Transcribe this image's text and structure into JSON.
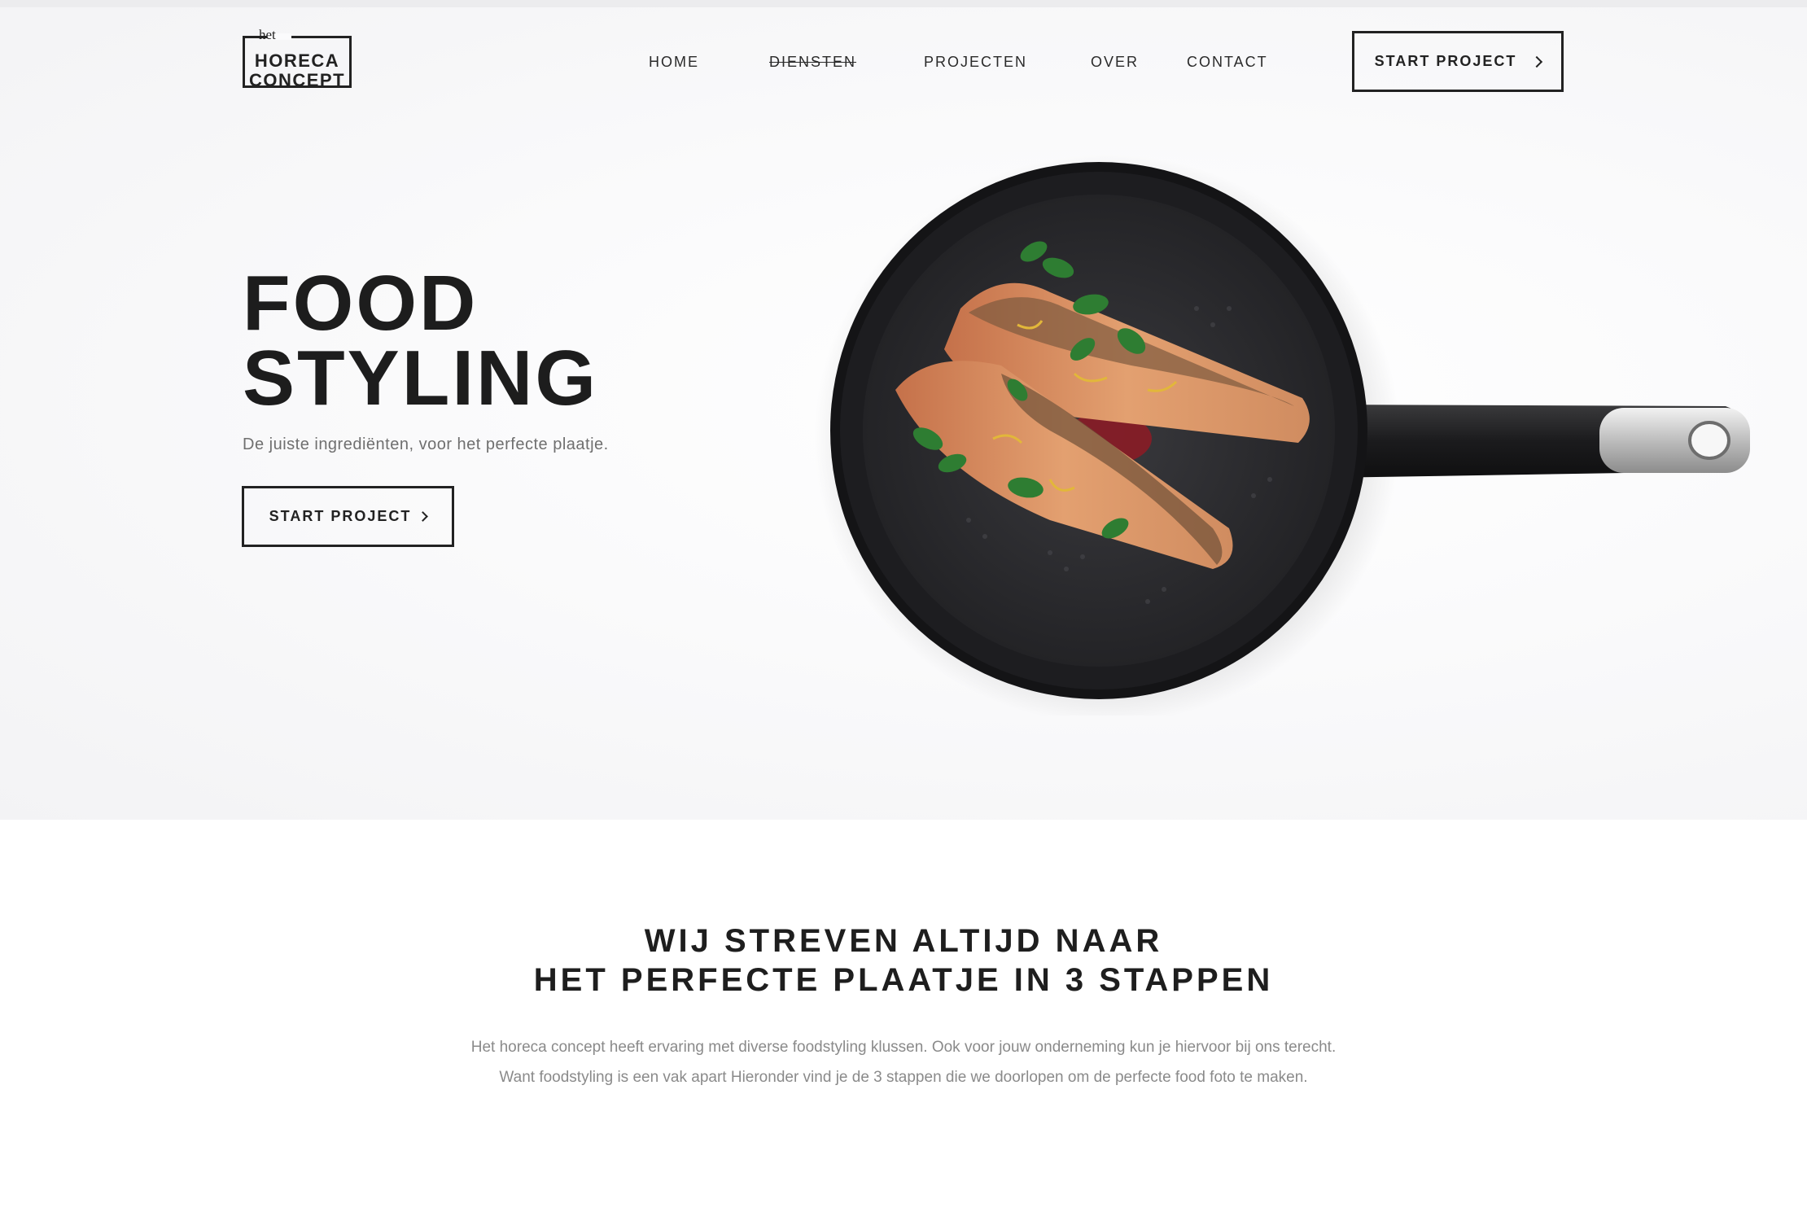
{
  "logo": {
    "small": "het",
    "line1": "HORECA",
    "line2": "CONCEPT"
  },
  "nav": {
    "items": [
      {
        "label": "HOME"
      },
      {
        "label": "DIENSTEN"
      },
      {
        "label": "PROJECTEN"
      },
      {
        "label": "OVER"
      },
      {
        "label": "CONTACT"
      }
    ],
    "cta_label": "START PROJECT"
  },
  "hero": {
    "title_line1": "FOOD",
    "title_line2": "STYLING",
    "subtitle": "De juiste ingrediënten, voor het perfecte plaatje.",
    "cta_label": "START PROJECT"
  },
  "section": {
    "heading_line1": "WIJ STREVEN ALTIJD NAAR",
    "heading_line2": "HET PERFECTE PLAATJE IN 3 STAPPEN",
    "paragraph_line1": "Het horeca concept heeft ervaring met diverse foodstyling klussen. Ook voor jouw onderneming kun je hiervoor bij ons terecht.",
    "paragraph_line2": "Want foodstyling is een vak apart  Hieronder vind je de 3 stappen die we doorlopen om de perfecte food foto te maken."
  },
  "colors": {
    "text": "#222222",
    "muted": "#8a8a8a",
    "hero_bg": "#f5f5f7"
  }
}
